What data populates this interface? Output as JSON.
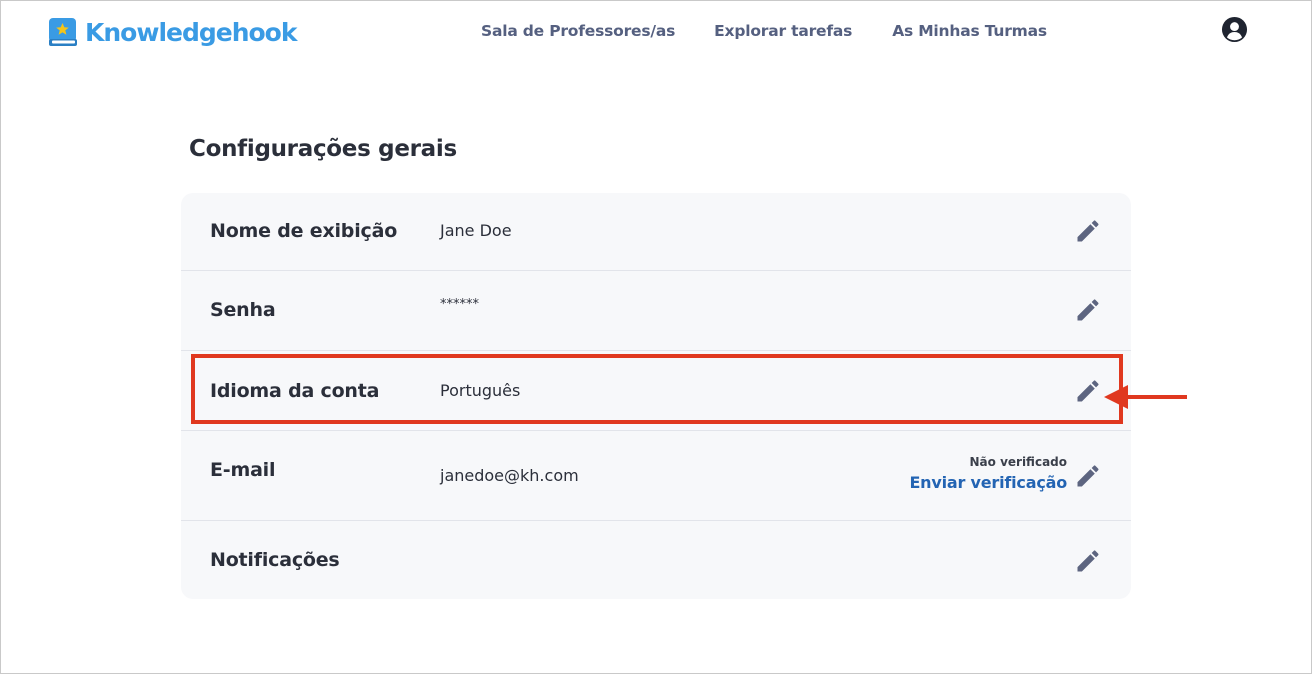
{
  "header": {
    "logo_text": "Knowledgehook",
    "nav": [
      {
        "label": "Sala de Professores/as"
      },
      {
        "label": "Explorar tarefas"
      },
      {
        "label": "As Minhas Turmas"
      }
    ],
    "account_icon": "user-circle-icon"
  },
  "page": {
    "title": "Configurações gerais"
  },
  "settings": {
    "display_name": {
      "label": "Nome de exibição",
      "value": "Jane Doe"
    },
    "password": {
      "label": "Senha",
      "value": "******"
    },
    "language": {
      "label": "Idioma da conta",
      "value": "Português"
    },
    "email": {
      "label": "E-mail",
      "value": "janedoe@kh.com",
      "status": "Não verificado",
      "action": "Enviar verificação"
    },
    "notifications": {
      "label": "Notificações"
    }
  },
  "colors": {
    "brand": "#3a9be4",
    "nav_text": "#556080",
    "link": "#2364b3",
    "annotation": "#e0381f",
    "edit_icon": "#5d6580"
  }
}
